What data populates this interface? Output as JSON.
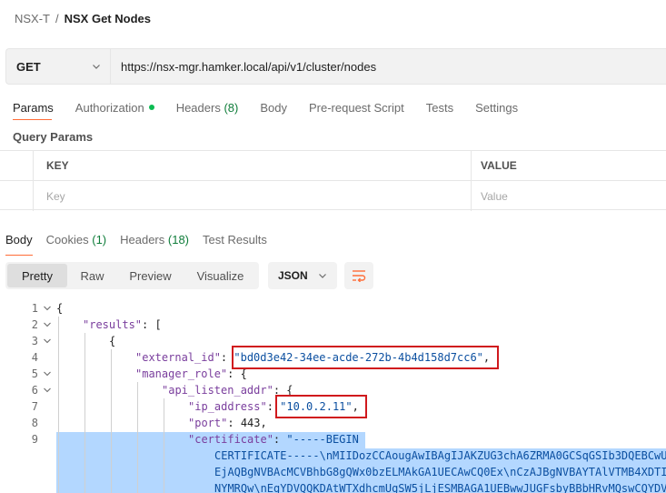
{
  "breadcrumb": {
    "parent": "NSX-T",
    "separator": "/",
    "title": "NSX Get Nodes"
  },
  "request": {
    "method": "GET",
    "url": "https://nsx-mgr.hamker.local/api/v1/cluster/nodes"
  },
  "request_tabs": {
    "params": "Params",
    "authorization": "Authorization",
    "headers": "Headers",
    "headers_count": "(8)",
    "body": "Body",
    "pre_request": "Pre-request Script",
    "tests": "Tests",
    "settings": "Settings"
  },
  "query_params": {
    "title": "Query Params",
    "col_key": "KEY",
    "col_value": "VALUE",
    "key_placeholder": "Key",
    "value_placeholder": "Value"
  },
  "response_tabs": {
    "body": "Body",
    "cookies": "Cookies",
    "cookies_count": "(1)",
    "headers": "Headers",
    "headers_count": "(18)",
    "test_results": "Test Results"
  },
  "view_modes": {
    "pretty": "Pretty",
    "raw": "Raw",
    "preview": "Preview",
    "visualize": "Visualize",
    "format": "JSON"
  },
  "code": {
    "l1": {
      "num": "1",
      "text": "{"
    },
    "l2": {
      "num": "2",
      "key": "\"results\"",
      "rest": ": ["
    },
    "l3": {
      "num": "3",
      "text": "{"
    },
    "l4": {
      "num": "4",
      "key": "\"external_id\"",
      "colon": ": ",
      "value": "\"bd0d3e42-34ee-acde-272b-4b4d158d7cc6\"",
      "comma": ","
    },
    "l5": {
      "num": "5",
      "key": "\"manager_role\"",
      "rest": ": {"
    },
    "l6": {
      "num": "6",
      "key": "\"api_listen_addr\"",
      "rest": ": {"
    },
    "l7": {
      "num": "7",
      "key": "\"ip_address\"",
      "colon": ": ",
      "value": "\"10.0.2.11\"",
      "comma": ","
    },
    "l8": {
      "num": "8",
      "key": "\"port\"",
      "colon": ": ",
      "value": "443",
      "comma": ","
    },
    "l9": {
      "num": "9",
      "key": "\"certificate\"",
      "colon": ": ",
      "value": "\"-----BEGIN"
    },
    "cert_2": "CERTIFICATE-----\\nMIIDozCCAougAwIBAgIJAKZUG3chA6ZRMA0GCSqGSIb3DQEBCwU",
    "cert_3": "EjAQBgNVBAcMCVBhbG8gQWx0bzELMAkGA1UECAwCQ0Ex\\nCzAJBgNVBAYTAlVTMB4XDTI",
    "cert_4": "NYMRQw\\nEgYDVQQKDAtWTXdhcmUgSW5jLjESMBAGA1UEBwwJUGFsbyBBbHRvMQswCQYDV"
  },
  "colors": {
    "accent": "#ff6c37",
    "status_dot": "#0cbb52",
    "highlight_box": "#d0191d",
    "selection": "#b3d7ff"
  },
  "icons": {
    "method_dropdown": "chevron-down-icon",
    "format_dropdown": "chevron-down-icon",
    "wrap": "wrap-lines-icon",
    "fold": "fold-chevron-icon"
  }
}
